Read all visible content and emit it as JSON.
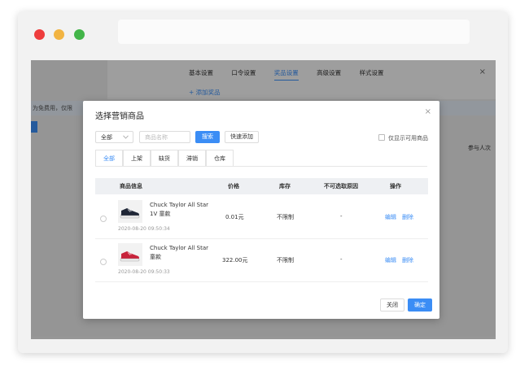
{
  "background": {
    "tabs": [
      "基本设置",
      "口令设置",
      "奖品设置",
      "高级设置",
      "样式设置"
    ],
    "active_tab": "奖品设置",
    "add_prize": "+ 添加奖品",
    "close_icon": "×",
    "notice": "为免费用，仅限",
    "column_partial": "参与人次"
  },
  "modal": {
    "title": "选择营销商品",
    "close_icon": "×",
    "filter": {
      "select_value": "全部",
      "search_placeholder": "商品名称",
      "search_button": "搜索",
      "quick_add_button": "快速添加",
      "only_available_label": "仅显示可用商品"
    },
    "tabs": [
      "全部",
      "上架",
      "缺货",
      "滞销",
      "仓库"
    ],
    "active_tab": "全部",
    "columns": [
      "商品信息",
      "价格",
      "库存",
      "不可选取原因",
      "操作"
    ],
    "rows": [
      {
        "name": "Chuck Taylor All Star 1V 童款",
        "date": "2020-08-20 09:50:34",
        "price": "0.01元",
        "stock": "不限制",
        "reason": "-",
        "edit": "编辑",
        "delete": "删除",
        "shoe_color": "#1f2636"
      },
      {
        "name": "Chuck Taylor All Star 童款",
        "date": "2020-08-20 09:50:33",
        "price": "322.00元",
        "stock": "不限制",
        "reason": "-",
        "edit": "编辑",
        "delete": "删除",
        "shoe_color": "#c8233b"
      }
    ],
    "footer": {
      "close": "关闭",
      "confirm": "确定"
    }
  },
  "colors": {
    "accent": "#3b8df5"
  }
}
